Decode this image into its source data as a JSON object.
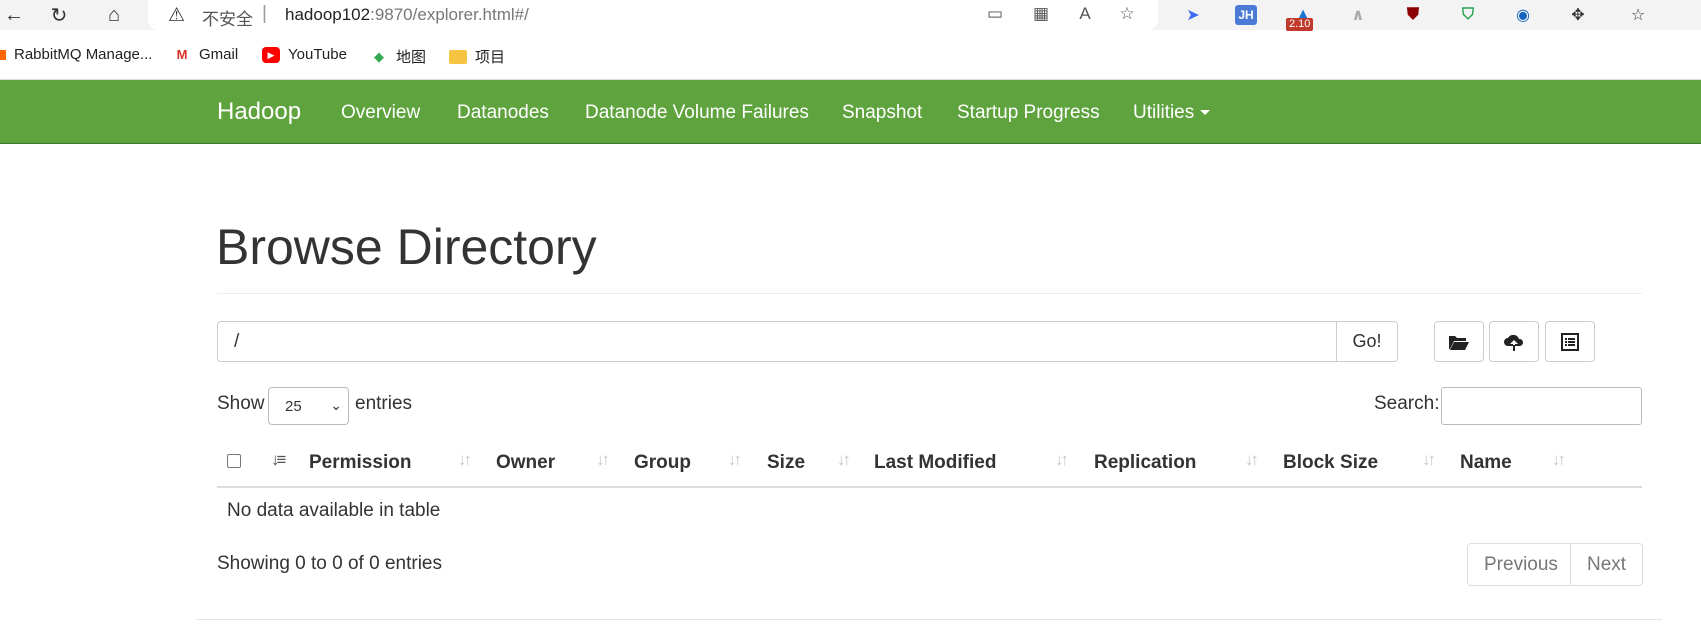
{
  "browser": {
    "security_label": "不安全",
    "url_host": "hadoop102",
    "url_rest": ":9870/explorer.html#/",
    "extension_badge": "2.10",
    "extension_jh": "JH"
  },
  "bookmarks": [
    {
      "label": "RabbitMQ Manage..."
    },
    {
      "label": "Gmail"
    },
    {
      "label": "YouTube"
    },
    {
      "label": "地图"
    },
    {
      "label": "项目"
    }
  ],
  "navbar": {
    "brand": "Hadoop",
    "items": [
      "Overview",
      "Datanodes",
      "Datanode Volume Failures",
      "Snapshot",
      "Startup Progress",
      "Utilities"
    ]
  },
  "page": {
    "title": "Browse Directory",
    "path_value": "/",
    "go_label": "Go!"
  },
  "table_controls": {
    "show_label": "Show",
    "page_size": "25",
    "entries_label": "entries",
    "search_label": "Search:"
  },
  "table": {
    "columns": [
      "Permission",
      "Owner",
      "Group",
      "Size",
      "Last Modified",
      "Replication",
      "Block Size",
      "Name"
    ],
    "empty_message": "No data available in table",
    "info": "Showing 0 to 0 of 0 entries",
    "previous_label": "Previous",
    "next_label": "Next"
  },
  "colors": {
    "navbar": "#5fa33e",
    "text": "#333333"
  }
}
